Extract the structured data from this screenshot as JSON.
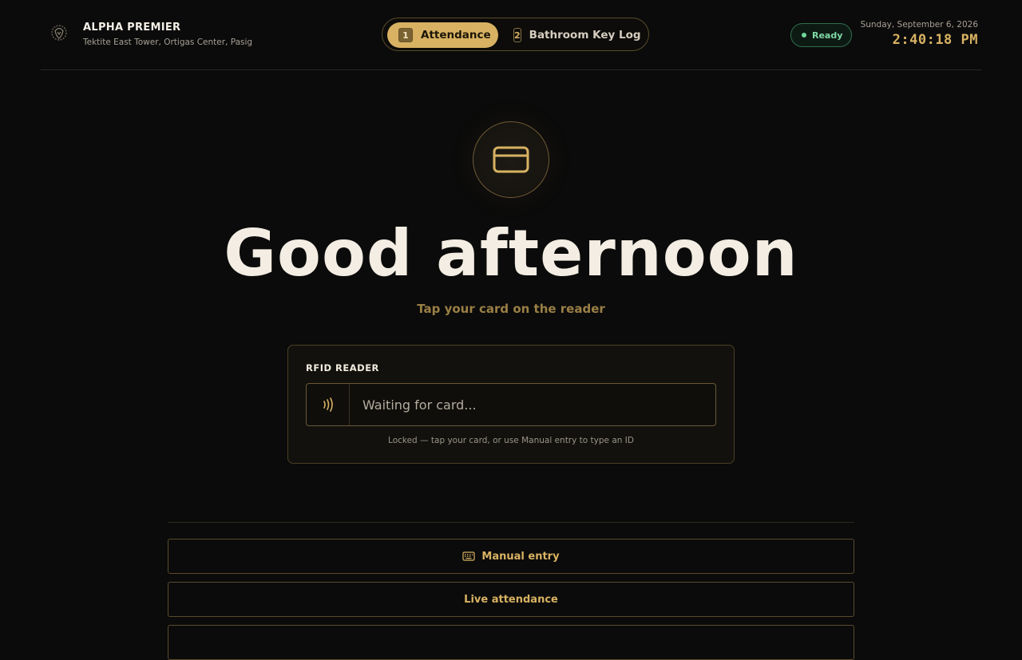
{
  "header": {
    "brand_name": "ALPHA PREMIER",
    "location": "Tektite East Tower, Ortigas Center, Pasig",
    "status": "Ready",
    "date": "Sunday, September 6, 2026",
    "time": "2:40:18 PM"
  },
  "tabs": [
    {
      "number": "1",
      "label": "Attendance",
      "active": true
    },
    {
      "number": "2",
      "label": "Bathroom Key Log",
      "active": false
    }
  ],
  "main": {
    "icon": "credit-card-icon",
    "greeting": "Good afternoon",
    "subtitle": "Tap your card on the reader"
  },
  "rfid": {
    "title": "RFID READER",
    "placeholder": "Waiting for card...",
    "note": "Locked  — tap your card, or use Manual entry to type an ID"
  },
  "actions": {
    "manual_label": "Manual entry",
    "live_label": "Live attendance"
  },
  "colors": {
    "accent": "#d8b262",
    "background": "#0b0b0b",
    "status_green": "#6fd69b"
  }
}
